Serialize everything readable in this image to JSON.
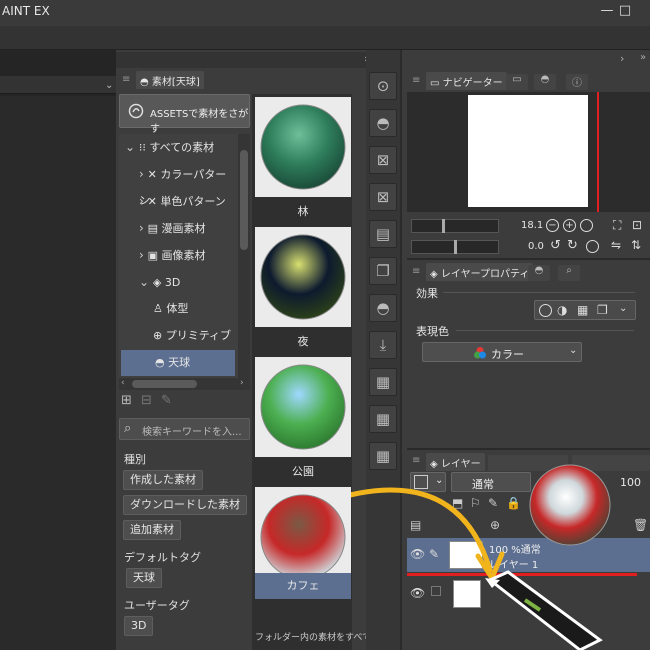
{
  "app": {
    "title": "AINT EX",
    "window_controls": [
      "minimize-icon",
      "maximize-icon"
    ]
  },
  "materials_panel": {
    "tab_label": "素材[天球]",
    "assets_button": "ASSETSで素材をさがす",
    "tree": [
      {
        "label": "すべての素材",
        "indent": 0,
        "expanded": true,
        "icon": "grid-icon"
      },
      {
        "label": "カラーパターン",
        "indent": 1,
        "expanded": false,
        "icon": "color-pattern-icon"
      },
      {
        "label": "単色パターン",
        "indent": 1,
        "expanded": false,
        "icon": "mono-pattern-icon"
      },
      {
        "label": "漫画素材",
        "indent": 1,
        "expanded": false,
        "icon": "manga-icon"
      },
      {
        "label": "画像素材",
        "indent": 1,
        "expanded": false,
        "icon": "image-icon"
      },
      {
        "label": "3D",
        "indent": 1,
        "expanded": true,
        "icon": "cube-icon"
      },
      {
        "label": "体型",
        "indent": 2,
        "icon": "body-icon"
      },
      {
        "label": "プリミティブ",
        "indent": 2,
        "icon": "primitive-icon"
      },
      {
        "label": "天球",
        "indent": 2,
        "selected": true,
        "icon": "sky-dome-icon"
      }
    ],
    "search_placeholder": "検索キーワードを入...",
    "type_heading": "種別",
    "type_buttons": [
      "作成した素材",
      "ダウンロードした素材",
      "追加素材"
    ],
    "default_tag_heading": "デフォルトタグ",
    "default_tags": [
      "天球"
    ],
    "user_tag_heading": "ユーザータグ",
    "user_tags": [
      "3D"
    ],
    "thumbnails": [
      {
        "label": "林",
        "palette": [
          "#2e7d5b",
          "#1b4d3a",
          "#6fbf9a"
        ]
      },
      {
        "label": "夜",
        "palette": [
          "#0d1a2e",
          "#2a3f1a",
          "#d8e070"
        ]
      },
      {
        "label": "公園",
        "palette": [
          "#4caf50",
          "#2f7d32",
          "#9fd8ff"
        ]
      },
      {
        "label": "カフェ",
        "palette": [
          "#c62828",
          "#cfd8dc",
          "#7a5a45"
        ],
        "selected": true
      }
    ],
    "footnote": "フォルダー内の素材をすべて"
  },
  "navigator": {
    "tab_label": "ナビゲーター",
    "zoom": "18.1",
    "rotation": "0.0"
  },
  "layer_property": {
    "tab_label": "レイヤープロパティ",
    "effect_label": "効果",
    "color_label": "表現色",
    "color_value": "カラー"
  },
  "layers": {
    "tab_label": "レイヤー",
    "blend_mode": "通常",
    "opacity": "100",
    "items": [
      {
        "opacity_text": "100 %通常",
        "name": "レイヤー 1",
        "selected": true
      },
      {
        "opacity_text": "",
        "name": "",
        "selected": false
      }
    ]
  },
  "colors": {
    "accent": "#5c6f91",
    "highlight_red": "#e02020",
    "arrow": "#f2b41c"
  }
}
